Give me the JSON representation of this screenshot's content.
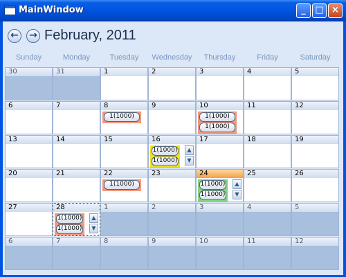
{
  "window": {
    "title": "MainWindow",
    "minimize_label": "_",
    "maximize_label": "□",
    "close_label": "×"
  },
  "header": {
    "month_title": "February, 2011",
    "prev_icon": "arrow-left-icon",
    "next_icon": "arrow-right-icon",
    "prev_glyph": "←",
    "next_glyph": "→"
  },
  "day_names": [
    "Sunday",
    "Monday",
    "Tuesday",
    "Wednesday",
    "Thursday",
    "Friday",
    "Saturday"
  ],
  "weeks": [
    [
      "30",
      "31",
      "1",
      "2",
      "3",
      "4",
      "5"
    ],
    [
      "6",
      "7",
      "8",
      "9",
      "10",
      "11",
      "12"
    ],
    [
      "13",
      "14",
      "15",
      "16",
      "17",
      "18",
      "19"
    ],
    [
      "20",
      "21",
      "22",
      "23",
      "24",
      "25",
      "26"
    ],
    [
      "27",
      "28",
      "1",
      "2",
      "3",
      "4",
      "5"
    ],
    [
      "6",
      "7",
      "8",
      "9",
      "10",
      "11",
      "12"
    ]
  ],
  "appointment_label": "1(1000)",
  "scroll_up_glyph": "▲",
  "scroll_down_glyph": "▼",
  "colors": {
    "appointment_red": "#f8957a",
    "appointment_yellow": "#f2e21a",
    "appointment_green": "#83d57a",
    "today_header": "#f1a04a",
    "other_month_cell": "#a8bfde"
  }
}
